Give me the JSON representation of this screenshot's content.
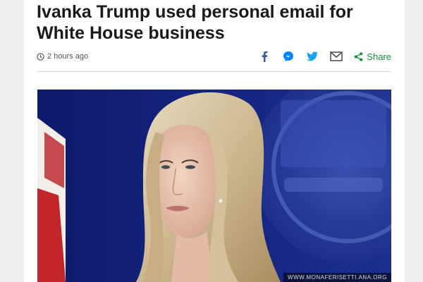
{
  "article": {
    "headline": "Ivanka Trump used personal email for White House business",
    "timestamp": "2 hours ago"
  },
  "share": {
    "label": "Share",
    "buttons": [
      {
        "name": "facebook",
        "icon": "facebook-icon",
        "color": "#3b5998"
      },
      {
        "name": "messenger",
        "icon": "messenger-icon",
        "color": "#0084ff"
      },
      {
        "name": "twitter",
        "icon": "twitter-icon",
        "color": "#1da1f2"
      },
      {
        "name": "email",
        "icon": "email-icon",
        "color": "#555555"
      }
    ],
    "accent": "#1a8c3a"
  },
  "hero_image": {
    "credit": "WWW.MONAFERISETTI.ANA.ORG"
  }
}
